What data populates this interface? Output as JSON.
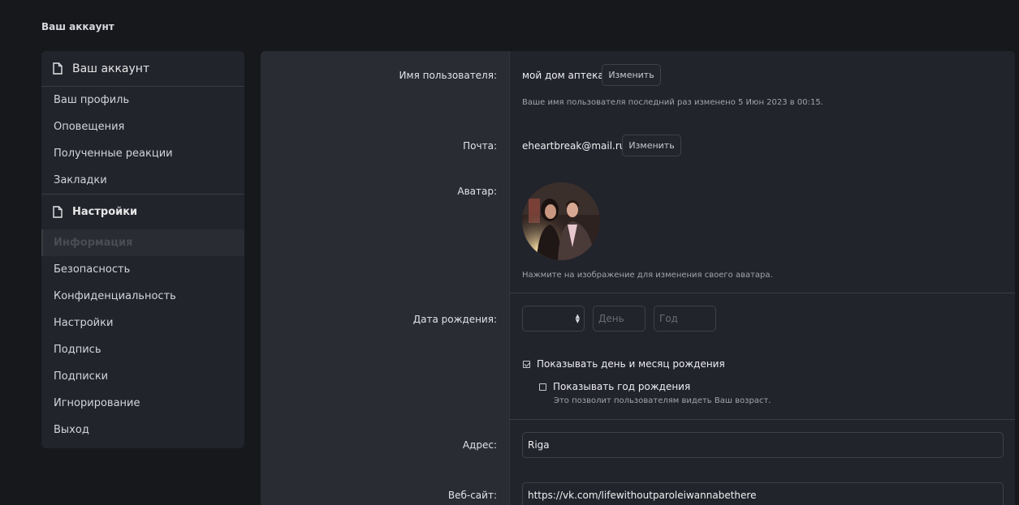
{
  "page_heading": "Ваш аккаунт",
  "sidebar": {
    "section_account": "Ваш аккаунт",
    "account_items": [
      {
        "label": "Ваш профиль"
      },
      {
        "label": "Оповещения"
      },
      {
        "label": "Полученные реакции"
      },
      {
        "label": "Закладки"
      }
    ],
    "section_settings": "Настройки",
    "settings_items": [
      {
        "label": "Информация",
        "active": true
      },
      {
        "label": "Безопасность"
      },
      {
        "label": "Конфиденциальность"
      },
      {
        "label": "Настройки"
      },
      {
        "label": "Подпись"
      },
      {
        "label": "Подписки"
      },
      {
        "label": "Игнорирование"
      },
      {
        "label": "Выход"
      }
    ]
  },
  "form": {
    "username_label": "Имя пользователя:",
    "username_value": "мой дом аптека",
    "username_change": "Изменить",
    "username_hint": "Ваше имя пользователя последний раз изменено 5 Июн 2023 в 00:15.",
    "email_label": "Почта:",
    "email_value": "eheartbreak@mail.ru",
    "email_change": "Изменить",
    "avatar_label": "Аватар:",
    "avatar_hint": "Нажмите на изображение для изменения своего аватара.",
    "dob_label": "Дата рождения:",
    "dob_month_value": "",
    "dob_day_placeholder": "День",
    "dob_year_placeholder": "Год",
    "show_day_month_label": "Показывать день и месяц рождения",
    "show_day_month_checked": true,
    "show_year_label": "Показывать год рождения",
    "show_year_checked": false,
    "show_year_hint": "Это позволит пользователям видеть Ваш возраст.",
    "address_label": "Адрес:",
    "address_value": "Riga",
    "website_label": "Веб-сайт:",
    "website_value": "https://vk.com/lifewithoutparoleiwannabethere"
  },
  "colors": {
    "page_bg": "#17181c",
    "panel_bg": "#22242c",
    "label_column_bg": "#2a2c33"
  }
}
